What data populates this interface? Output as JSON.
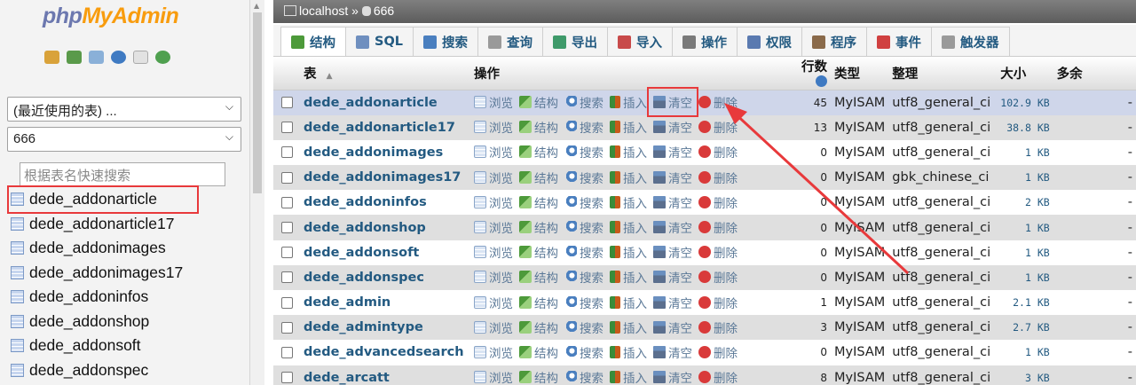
{
  "nav": {
    "logo_part1": "php",
    "logo_part2": "MyAdmin",
    "icons": [
      "home-icon",
      "exit-icon",
      "query-icon",
      "help-icon",
      "docs-icon",
      "reload-icon"
    ],
    "recent_select": "(最近使用的表) ...",
    "db_select": "666",
    "filter_placeholder": "根据表名快速搜索",
    "tables": [
      "dede_addonarticle",
      "dede_addonarticle17",
      "dede_addonimages",
      "dede_addonimages17",
      "dede_addoninfos",
      "dede_addonshop",
      "dede_addonsoft",
      "dede_addonspec"
    ]
  },
  "breadcrumb": {
    "server": "localhost",
    "sep": "»",
    "database": "666"
  },
  "tabs": [
    {
      "label": "结构",
      "icon": "structure-icon",
      "color": "#4d9a3a"
    },
    {
      "label": "SQL",
      "icon": "sql-icon",
      "color": "#6f8fbf"
    },
    {
      "label": "搜索",
      "icon": "search-icon",
      "color": "#4a7fbf"
    },
    {
      "label": "查询",
      "icon": "query-icon",
      "color": "#9a9a9a"
    },
    {
      "label": "导出",
      "icon": "export-icon",
      "color": "#3f9a6a"
    },
    {
      "label": "导入",
      "icon": "import-icon",
      "color": "#c84a4a"
    },
    {
      "label": "操作",
      "icon": "wrench-icon",
      "color": "#7a7a7a"
    },
    {
      "label": "权限",
      "icon": "privileges-icon",
      "color": "#5a7ab0"
    },
    {
      "label": "程序",
      "icon": "routines-icon",
      "color": "#8a6a4a"
    },
    {
      "label": "事件",
      "icon": "events-icon",
      "color": "#d04040"
    },
    {
      "label": "触发器",
      "icon": "triggers-icon",
      "color": "#9a9a9a"
    }
  ],
  "columns": {
    "table": "表",
    "sort": "▲",
    "actions": "操作",
    "rows": "行数",
    "type": "类型",
    "collation": "整理",
    "size": "大小",
    "overhead": "多余"
  },
  "actions": {
    "browse": "浏览",
    "structure": "结构",
    "search": "搜索",
    "insert": "插入",
    "empty": "清空",
    "drop": "删除"
  },
  "rows": [
    {
      "name": "dede_addonarticle",
      "rows": "45",
      "type": "MyISAM",
      "collation": "utf8_general_ci",
      "size": "102.9 KB",
      "overhead": "-"
    },
    {
      "name": "dede_addonarticle17",
      "rows": "13",
      "type": "MyISAM",
      "collation": "utf8_general_ci",
      "size": "38.8 KB",
      "overhead": "-"
    },
    {
      "name": "dede_addonimages",
      "rows": "0",
      "type": "MyISAM",
      "collation": "utf8_general_ci",
      "size": "1 KB",
      "overhead": "-"
    },
    {
      "name": "dede_addonimages17",
      "rows": "0",
      "type": "MyISAM",
      "collation": "gbk_chinese_ci",
      "size": "1 KB",
      "overhead": "-"
    },
    {
      "name": "dede_addoninfos",
      "rows": "0",
      "type": "MyISAM",
      "collation": "utf8_general_ci",
      "size": "2 KB",
      "overhead": "-"
    },
    {
      "name": "dede_addonshop",
      "rows": "0",
      "type": "MyISAM",
      "collation": "utf8_general_ci",
      "size": "1 KB",
      "overhead": "-"
    },
    {
      "name": "dede_addonsoft",
      "rows": "0",
      "type": "MyISAM",
      "collation": "utf8_general_ci",
      "size": "1 KB",
      "overhead": "-"
    },
    {
      "name": "dede_addonspec",
      "rows": "0",
      "type": "MyISAM",
      "collation": "utf8_general_ci",
      "size": "1 KB",
      "overhead": "-"
    },
    {
      "name": "dede_admin",
      "rows": "1",
      "type": "MyISAM",
      "collation": "utf8_general_ci",
      "size": "2.1 KB",
      "overhead": "-"
    },
    {
      "name": "dede_admintype",
      "rows": "3",
      "type": "MyISAM",
      "collation": "utf8_general_ci",
      "size": "2.7 KB",
      "overhead": "-"
    },
    {
      "name": "dede_advancedsearch",
      "rows": "0",
      "type": "MyISAM",
      "collation": "utf8_general_ci",
      "size": "1 KB",
      "overhead": "-"
    },
    {
      "name": "dede_arcatt",
      "rows": "8",
      "type": "MyISAM",
      "collation": "utf8_general_ci",
      "size": "3 KB",
      "overhead": "-"
    }
  ],
  "colors": {
    "link": "#235a81",
    "highlight": "#e8393b",
    "logo_php": "#6c78af",
    "logo_myadmin": "#f89c0e"
  }
}
